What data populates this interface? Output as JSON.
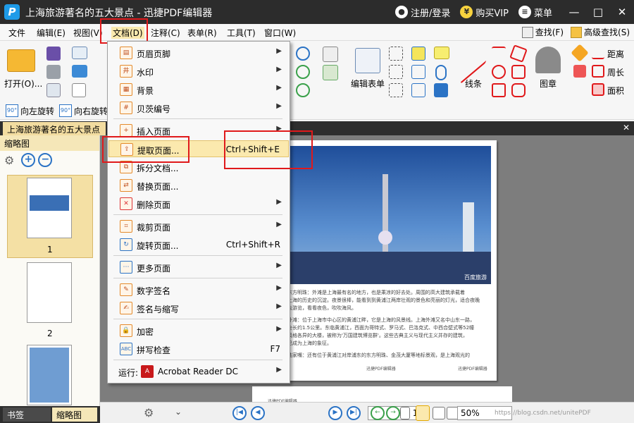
{
  "window": {
    "logo": "P",
    "title": "上海旅游著名的五大景点 - 迅捷PDF编辑器",
    "login": "注册/登录",
    "vip": "购买VIP",
    "menu": "菜单",
    "minimize": "—",
    "maximize": "□",
    "close": "✕"
  },
  "menubar": {
    "items": [
      "文件",
      "编辑(E)",
      "视图(V)",
      "文档(D)",
      "注释(C)",
      "表单(R)",
      "工具(T)",
      "窗口(W)"
    ],
    "find": "查找(F)",
    "advanced_find": "高级查找(S)"
  },
  "ribbon": {
    "open": "打开(O)...",
    "rotate_left": "向左旋转",
    "rotate_right": "向右旋转",
    "rotate_badge": "90°",
    "edit_form": "编辑表单",
    "line": "线条",
    "stamp": "图章",
    "distance": "距离",
    "perimeter": "周长",
    "area": "面积"
  },
  "doc_tab": {
    "title": "上海旅游著名的五大景点 *",
    "close": "✕"
  },
  "sidebar": {
    "header": "缩略图",
    "thumb_labels": [
      "1",
      "2"
    ]
  },
  "bottom_tabs": {
    "bookmarks": "书签",
    "thumbnails": "缩略图"
  },
  "document_menu": {
    "items": [
      {
        "label": "页眉页脚",
        "icon": "header-footer-icon",
        "glyph": "▤",
        "submenu": true
      },
      {
        "label": "水印",
        "icon": "watermark-icon",
        "glyph": "井",
        "submenu": true
      },
      {
        "label": "背景",
        "icon": "background-icon",
        "glyph": "▦",
        "submenu": true
      },
      {
        "label": "贝茨编号",
        "icon": "bates-number-icon",
        "glyph": "#",
        "submenu": true
      },
      {
        "label": "插入页面",
        "icon": "insert-page-icon",
        "glyph": "+",
        "submenu": true
      },
      {
        "label": "提取页面...",
        "icon": "extract-page-icon",
        "glyph": "⇪",
        "shortcut": "Ctrl+Shift+E",
        "highlighted": true
      },
      {
        "label": "拆分文档...",
        "icon": "split-document-icon",
        "glyph": "⧉"
      },
      {
        "label": "替换页面...",
        "icon": "replace-page-icon",
        "glyph": "⇄"
      },
      {
        "label": "删除页面",
        "icon": "delete-page-icon",
        "glyph": "✕",
        "submenu": true
      },
      {
        "label": "裁剪页面",
        "icon": "crop-page-icon",
        "glyph": "⌗",
        "submenu": true
      },
      {
        "label": "旋转页面...",
        "icon": "rotate-page-icon",
        "glyph": "↻",
        "shortcut": "Ctrl+Shift+R"
      },
      {
        "label": "更多页面",
        "icon": "more-pages-icon",
        "glyph": "⋯",
        "submenu": true
      },
      {
        "label": "数字签名",
        "icon": "digital-signature-icon",
        "glyph": "✎",
        "submenu": true
      },
      {
        "label": "签名与缩写",
        "icon": "signature-initials-icon",
        "glyph": "✍",
        "submenu": true
      },
      {
        "label": "加密",
        "icon": "encrypt-icon",
        "glyph": "🔒",
        "submenu": true
      },
      {
        "label": "拼写检查",
        "icon": "spell-check-icon",
        "glyph": "ABC",
        "shortcut": "F7"
      },
      {
        "label": "Acrobat Reader DC",
        "prefix": "运行:",
        "icon": "acrobat-icon",
        "glyph": "A",
        "submenu": true
      }
    ]
  },
  "pdf_page": {
    "photo_caption": "百度旅游",
    "text_lines": [
      "东方明珠：外滩是上海最有名的地方，也是乘凉的好去处。周围的高大建筑承载着",
      "上海的历史的沉淀。夜景很棒，能看到到黄浦江两岸壮观的景色和亮丽的灯光，适合夜晚",
      "去游览，看看夜色，吹吹海风。",
      "外滩：位于上海市中心区的黄浦江畔，它是上海的风景线。上海外滩又名中山东一路，",
      "全长约1.5公里。东临黄浦江，西面为哥特式、罗马式、巴洛克式、中西合壁式等52幢",
      "风格各异的大楼，被称为'万国建筑博览群'。这些古典主义与现代主义并存的建筑，",
      "已成为上海的象征。",
      "陆家嘴：还有位于黄浦江对岸浦东的东方明珠、金茂大厦等地标景观，是上海观光的"
    ],
    "footer_left": "迅捷PDF编辑器",
    "footer_right": "迅捷PDF编辑器",
    "page2_footer": "迅捷PDF编辑器"
  },
  "statusbar": {
    "page": "1 / 14",
    "zoom": "50%",
    "watermark": "https://blog.csdn.net/unitePDF"
  },
  "colors": {
    "titlebar": "#2c2c2c",
    "highlight": "#fbe9ae",
    "annotation_red": "#e0191b",
    "accent_blue": "#2b73c5"
  }
}
